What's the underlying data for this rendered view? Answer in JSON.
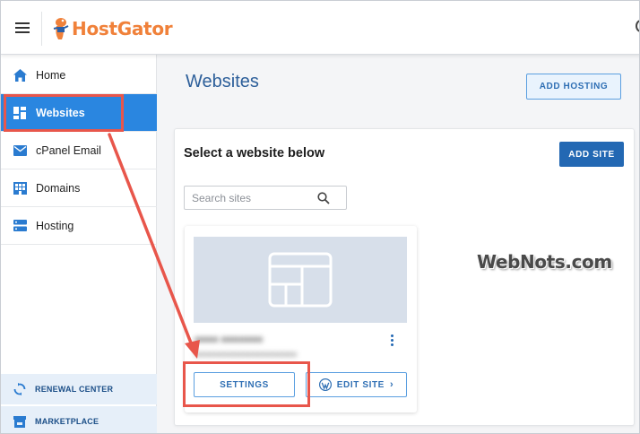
{
  "header": {
    "brand": "HostGator"
  },
  "sidebar": {
    "items": [
      {
        "label": "Home",
        "icon": "home-icon"
      },
      {
        "label": "Websites",
        "icon": "dashboard-icon",
        "active": true
      },
      {
        "label": "cPanel Email",
        "icon": "mail-icon"
      },
      {
        "label": "Domains",
        "icon": "domains-icon"
      },
      {
        "label": "Hosting",
        "icon": "server-icon"
      }
    ],
    "bottom": [
      {
        "label": "RENEWAL CENTER",
        "icon": "sync-icon"
      },
      {
        "label": "MARKETPLACE",
        "icon": "store-icon"
      }
    ]
  },
  "main": {
    "title": "Websites",
    "add_hosting_label": "ADD HOSTING",
    "panel_title": "Select a website below",
    "add_site_label": "ADD SITE",
    "search_placeholder": "Search sites",
    "site_card": {
      "settings_label": "SETTINGS",
      "edit_site_label": "EDIT SITE"
    }
  },
  "watermark": "WebNots.com",
  "colors": {
    "accent": "#2a86e0",
    "brand_orange": "#f0813a",
    "annotation": "#e8564b"
  }
}
